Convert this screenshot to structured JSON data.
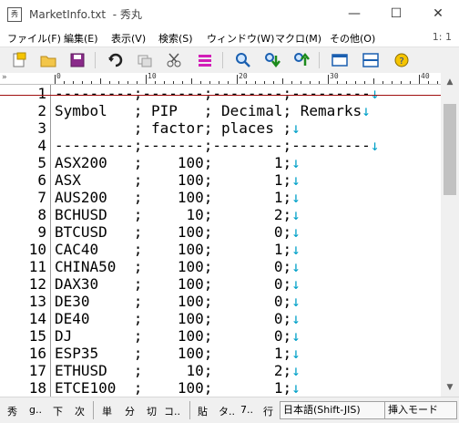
{
  "title_bar": {
    "icon_label": "秀",
    "title": "MarketInfo.txt  - 秀丸",
    "minimize": "—",
    "maximize": "☐",
    "close": "✕"
  },
  "menu": {
    "items": [
      "ファイル(F)",
      "編集(E)",
      "表示(V)",
      "検索(S)",
      "ウィンドウ(W)",
      "マクロ(M)",
      "その他(O)"
    ],
    "position": "1: 1"
  },
  "toolbar": {
    "icons": [
      "new-file-icon",
      "open-folder-icon",
      "save-icon",
      "undo-icon",
      "copy-icon",
      "cut-icon",
      "paste-icon",
      "search-icon",
      "search-down-icon",
      "search-up-icon",
      "window-icon",
      "split-icon",
      "help-icon"
    ]
  },
  "ruler": {
    "marker": "»",
    "numbers": [
      "0",
      "10",
      "20",
      "30",
      "40"
    ]
  },
  "editor": {
    "line_numbers": [
      "1",
      "2",
      "3",
      "4",
      "5",
      "6",
      "7",
      "8",
      "9",
      "10",
      "11",
      "12",
      "13",
      "14",
      "15",
      "16",
      "17",
      "18"
    ],
    "lines": [
      "---------;-------;--------;---------",
      "Symbol   ; PIP   ; Decimal; Remarks",
      "         ; factor; places ;",
      "---------;-------;--------;---------",
      "ASX200   ;    100;       1;",
      "ASX      ;    100;       1;",
      "AUS200   ;    100;       1;",
      "BCHUSD   ;     10;       2;",
      "BTCUSD   ;    100;       0;",
      "CAC40    ;    100;       1;",
      "CHINA50  ;    100;       0;",
      "DAX30    ;    100;       0;",
      "DE30     ;    100;       0;",
      "DE40     ;    100;       0;",
      "DJ       ;    100;       0;",
      "ESP35    ;    100;       1;",
      "ETHUSD   ;     10;       2;",
      "ETCE100  ;    100;       1;"
    ],
    "eol_marker": "↓"
  },
  "statusbar": {
    "items": [
      "秀",
      "g..",
      "下",
      "次",
      "単",
      "分",
      "切",
      "コ..",
      "貼",
      "タ..",
      "7..",
      "行"
    ],
    "encoding": "日本語(Shift-JIS)",
    "mode": "挿入モード"
  }
}
